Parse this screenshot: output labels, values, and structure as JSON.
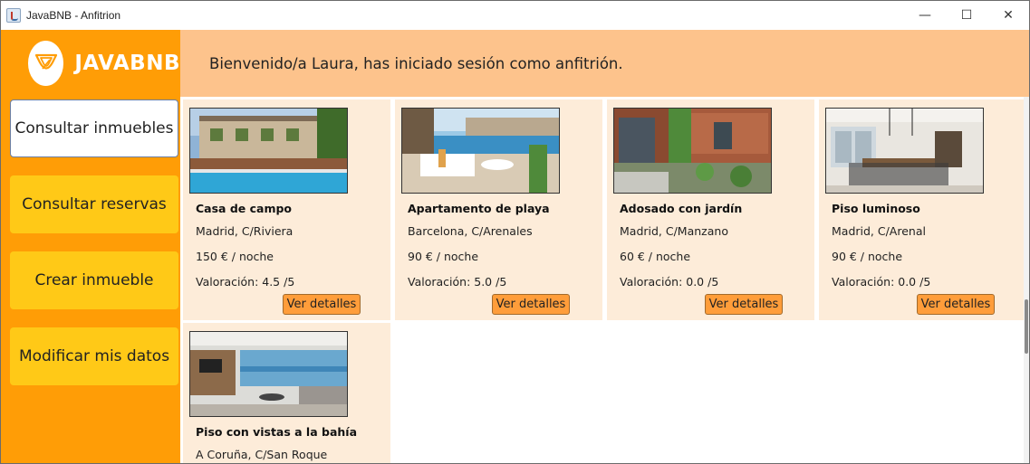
{
  "window": {
    "title": "JavaBNB - Anfitrion",
    "minimize_glyph": "—",
    "maximize_glyph": "☐",
    "close_glyph": "✕"
  },
  "logo": {
    "text": "JAVABNB",
    "icon": "javabnb-logo-icon"
  },
  "sidebar": {
    "items": [
      {
        "label": "Consultar inmuebles",
        "active": true
      },
      {
        "label": "Consultar reservas",
        "active": false
      },
      {
        "label": "Crear inmueble",
        "active": false
      },
      {
        "label": "Modificar mis datos",
        "active": false
      }
    ]
  },
  "header": {
    "welcome": "Bienvenido/a Laura, has iniciado sesión como anfitrión."
  },
  "colors": {
    "sidebar": "#ff9d06",
    "nav_button": "#ffc917",
    "header": "#fdc38c",
    "card": "#fdecd9",
    "detail_button": "#ff9d3a"
  },
  "listings": [
    {
      "name": "Casa de campo",
      "location": "Madrid, C/Riviera",
      "price": "150 € / noche",
      "rating": "Valoración: 4.5 /5",
      "button": "Ver detalles",
      "photo": "country-house-with-pool-photo"
    },
    {
      "name": "Apartamento de playa",
      "location": "Barcelona, C/Arenales",
      "price": "90 € / noche",
      "rating": "Valoración: 5.0 /5",
      "button": "Ver detalles",
      "photo": "beach-apartment-terrace-photo"
    },
    {
      "name": "Adosado con jardín",
      "location": "Madrid, C/Manzano",
      "price": "60 € / noche",
      "rating": "Valoración: 0.0 /5",
      "button": "Ver detalles",
      "photo": "townhouse-garden-photo"
    },
    {
      "name": "Piso luminoso",
      "location": "Madrid, C/Arenal",
      "price": "90 € / noche",
      "rating": "Valoración: 0.0 /5",
      "button": "Ver detalles",
      "photo": "bright-flat-dining-photo"
    },
    {
      "name": "Piso con vistas a la bahía",
      "location": "A Coruña, C/San Roque",
      "photo": "bay-view-living-room-photo"
    }
  ]
}
